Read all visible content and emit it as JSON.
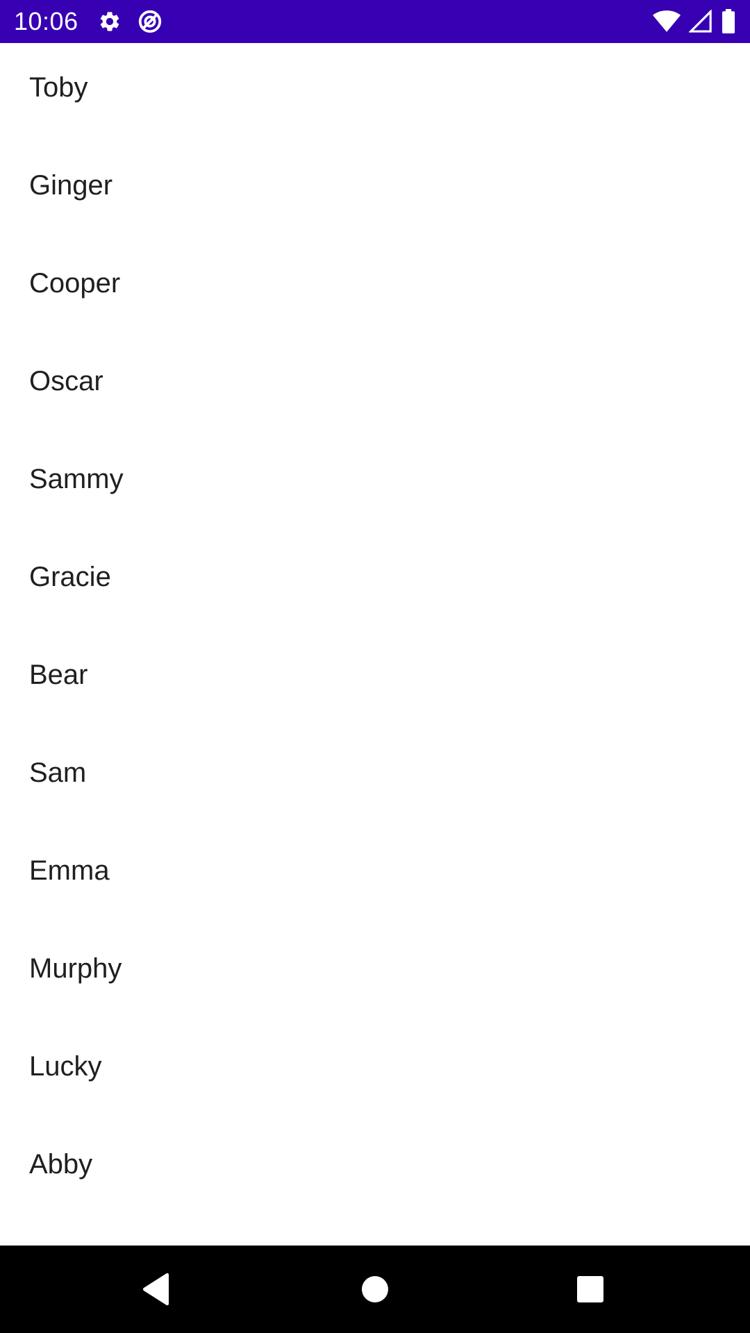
{
  "status_bar": {
    "time": "10:06",
    "background": "#3700b3",
    "icons": [
      "settings-icon",
      "data-saver-icon",
      "wifi-icon",
      "signal-icon",
      "battery-icon"
    ]
  },
  "list": {
    "items": [
      {
        "label": "Toby"
      },
      {
        "label": "Ginger"
      },
      {
        "label": "Cooper"
      },
      {
        "label": "Oscar"
      },
      {
        "label": "Sammy"
      },
      {
        "label": "Gracie"
      },
      {
        "label": "Bear"
      },
      {
        "label": "Sam"
      },
      {
        "label": "Emma"
      },
      {
        "label": "Murphy"
      },
      {
        "label": "Lucky"
      },
      {
        "label": "Abby"
      }
    ]
  },
  "nav_bar": {
    "background": "#000000",
    "buttons": [
      "back-icon",
      "home-icon",
      "recents-icon"
    ]
  }
}
